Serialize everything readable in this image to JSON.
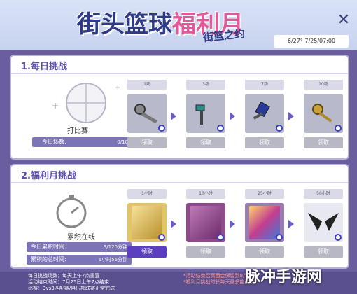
{
  "header": {
    "title_a": "街头篮球",
    "title_b": "福利月",
    "subtitle": "街篮之约",
    "date_range": "6/27° 7/25/07:00",
    "close_label": "✕"
  },
  "section1": {
    "title": "1.每日挑战",
    "center_label": "打比赛",
    "bar_label": "今日场数:",
    "bar_value": "0/10场",
    "items": [
      {
        "count": "1场",
        "button": "领取"
      },
      {
        "count": "3场",
        "button": "领取"
      },
      {
        "count": "7场",
        "button": "领取"
      },
      {
        "count": "10场",
        "button": "领取"
      }
    ]
  },
  "section2": {
    "title": "2.福利月挑战",
    "center_label": "累积在线",
    "bars": [
      {
        "label": "今日累积时间:",
        "value": "3/120分钟"
      },
      {
        "label": "累积的总时间:",
        "value": "6小时56分钟"
      }
    ],
    "items": [
      {
        "count": "1小时",
        "button": "领取"
      },
      {
        "count": "10小时",
        "button": "领取"
      },
      {
        "count": "25小时",
        "button": "领取"
      },
      {
        "count": "50小时",
        "button": "领取"
      }
    ]
  },
  "footer": {
    "left_lines": [
      "每日挑战场数：每天上午7点重置",
      "活动结束时间：7月25日上午7点结束",
      "比赛：3vs3匹配赛/俱乐部联赛正常完成"
    ],
    "right_lines": [
      "*活动结束后页面会保留到8月1日",
      "*福利月挑战时长每天最多能累积"
    ]
  },
  "watermark": "脉冲手游网"
}
